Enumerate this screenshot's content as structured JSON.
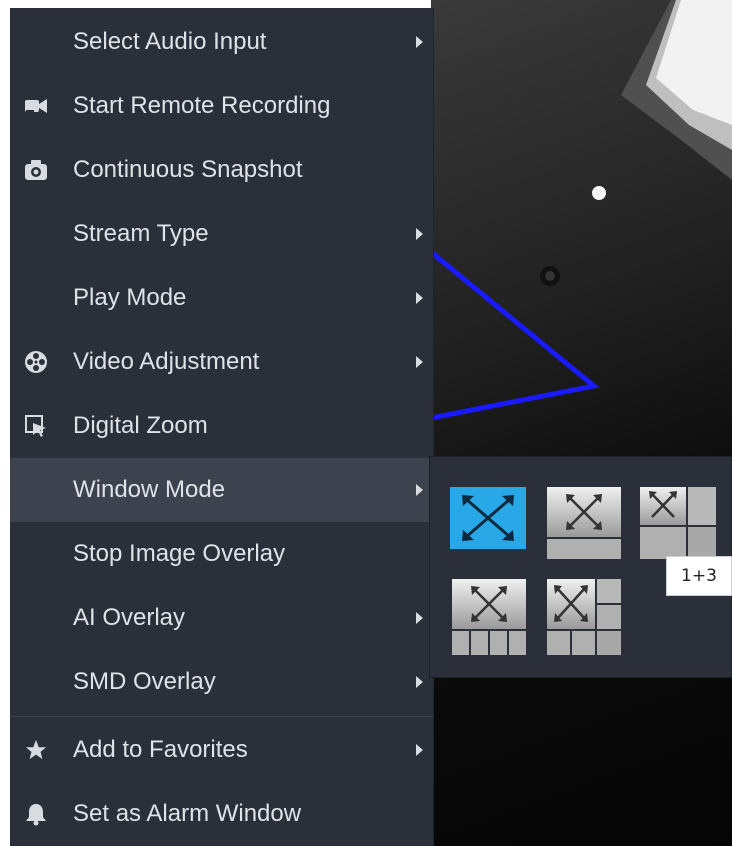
{
  "menu": {
    "items": [
      {
        "label": "Select Audio Input",
        "icon": "",
        "submenu": true
      },
      {
        "label": "Start Remote Recording",
        "icon": "video-camera-icon",
        "submenu": false
      },
      {
        "label": "Continuous Snapshot",
        "icon": "camera-icon",
        "submenu": false
      },
      {
        "label": "Stream Type",
        "icon": "",
        "submenu": true
      },
      {
        "label": "Play Mode",
        "icon": "",
        "submenu": true
      },
      {
        "label": "Video Adjustment",
        "icon": "film-reel-icon",
        "submenu": true
      },
      {
        "label": "Digital Zoom",
        "icon": "zoom-cursor-icon",
        "submenu": false
      },
      {
        "label": "Window Mode",
        "icon": "",
        "submenu": true,
        "active": true
      },
      {
        "label": "Stop Image Overlay",
        "icon": "",
        "submenu": false
      },
      {
        "label": "AI Overlay",
        "icon": "",
        "submenu": true
      },
      {
        "label": "SMD Overlay",
        "icon": "",
        "submenu": true
      },
      {
        "label": "Add to Favorites",
        "icon": "star-icon",
        "submenu": true
      },
      {
        "label": "Set as Alarm Window",
        "icon": "bell-icon",
        "submenu": false
      }
    ]
  },
  "window_mode": {
    "layouts": [
      {
        "id": "1",
        "selected": true
      },
      {
        "id": "1+1",
        "selected": false
      },
      {
        "id": "1+3",
        "selected": false
      },
      {
        "id": "1+4",
        "selected": false
      },
      {
        "id": "1+5",
        "selected": false
      }
    ],
    "tooltip": "1+3"
  },
  "colors": {
    "menu_bg": "#2a2f3a",
    "active_bg": "#3c424e",
    "selected_accent": "#29a8e8",
    "overlay_line": "#1a1aff"
  }
}
